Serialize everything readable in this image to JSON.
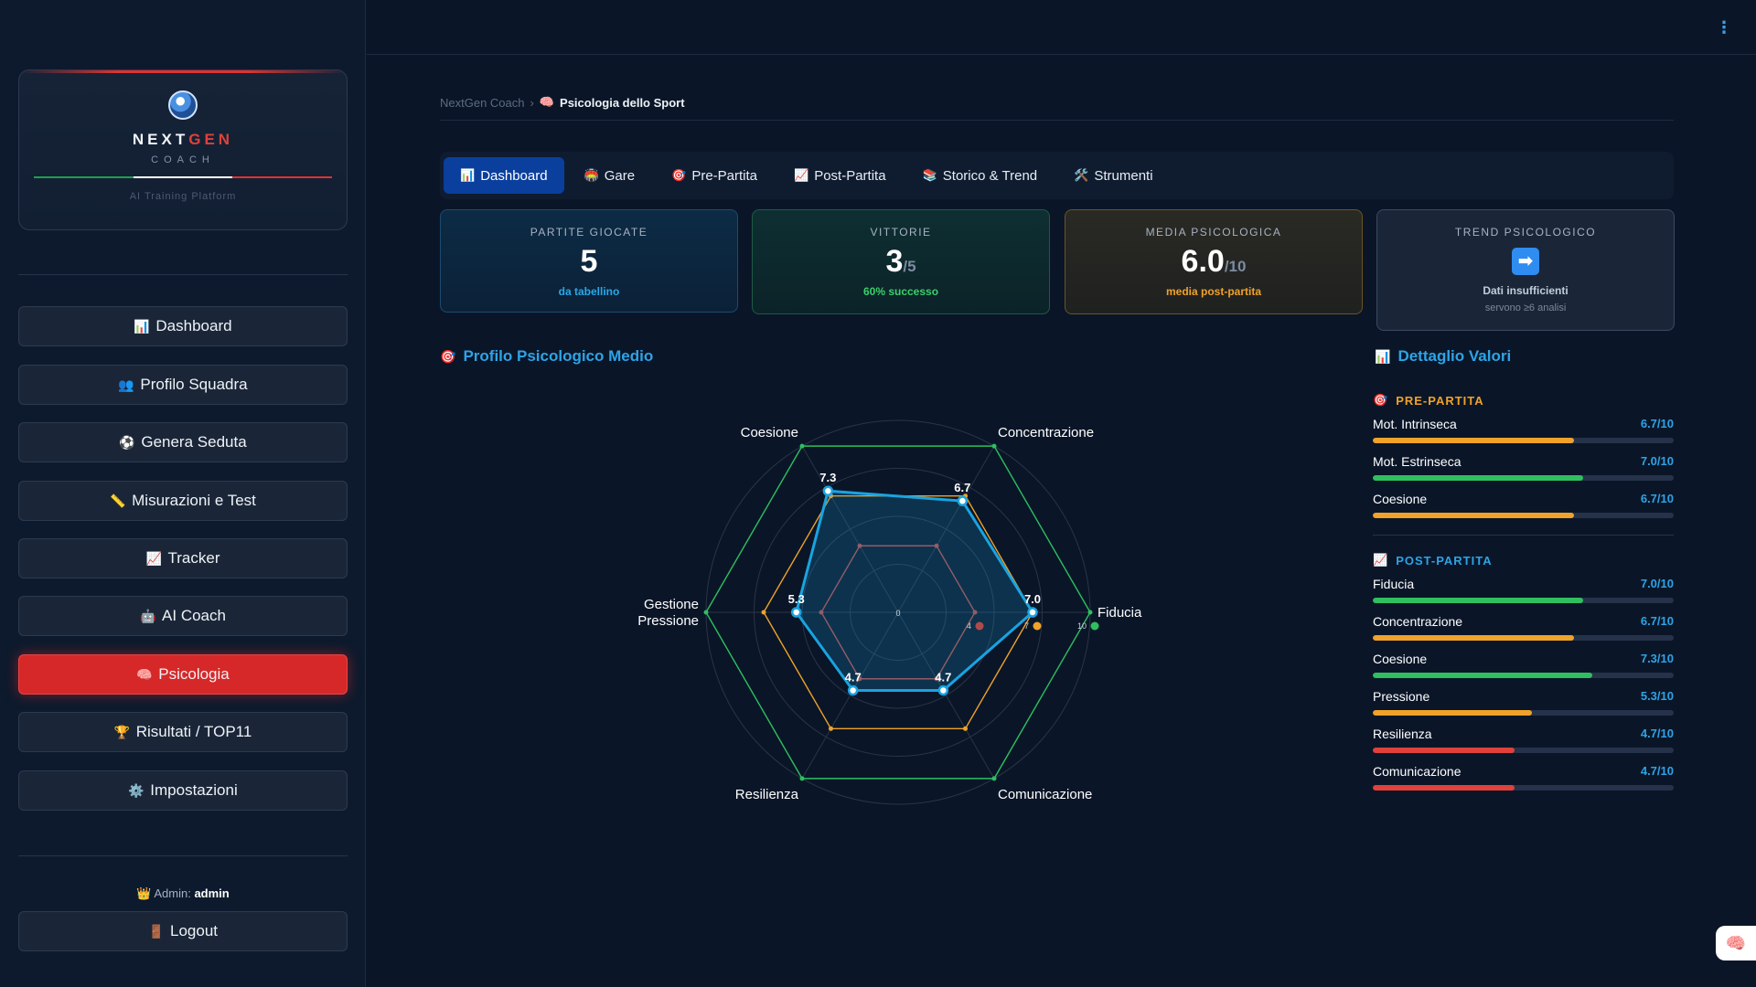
{
  "brand": {
    "name_a": "NEXT",
    "name_b": "GEN",
    "sub": "COACH",
    "tagline": "AI Training Platform",
    "colors": [
      "#1fa04a",
      "#ffffff",
      "#e0332f"
    ]
  },
  "sidebar": {
    "items": [
      {
        "icon": "📊",
        "icon_name": "chart-icon",
        "label": "Dashboard"
      },
      {
        "icon": "👥",
        "icon_name": "team-icon",
        "label": "Profilo Squadra"
      },
      {
        "icon": "⚽",
        "icon_name": "ball-icon",
        "label": "Genera Seduta"
      },
      {
        "icon": "📏",
        "icon_name": "ruler-icon",
        "label": "Misurazioni e Test"
      },
      {
        "icon": "📈",
        "icon_name": "trend-icon",
        "label": "Tracker"
      },
      {
        "icon": "🤖",
        "icon_name": "robot-icon",
        "label": "AI Coach"
      },
      {
        "icon": "🧠",
        "icon_name": "brain-icon",
        "label": "Psicologia",
        "active": true
      },
      {
        "icon": "🏆",
        "icon_name": "trophy-icon",
        "label": "Risultati / TOP11"
      },
      {
        "icon": "⚙️",
        "icon_name": "gear-icon",
        "label": "Impostazioni"
      }
    ],
    "admin_prefix": "Admin:",
    "admin_name": "admin",
    "admin_icon": "👑",
    "logout_icon": "🚪",
    "logout": "Logout"
  },
  "header": {
    "menu_icon": "⋮"
  },
  "breadcrumb": {
    "root": "NextGen Coach",
    "separator": "›",
    "icon": "🧠",
    "current": "Psicologia dello Sport"
  },
  "tabs": [
    {
      "icon": "📊",
      "label": "Dashboard",
      "active": true
    },
    {
      "icon": "🏟️",
      "label": "Gare"
    },
    {
      "icon": "🎯",
      "label": "Pre-Partita"
    },
    {
      "icon": "📈",
      "label": "Post-Partita"
    },
    {
      "icon": "📚",
      "label": "Storico & Trend"
    },
    {
      "icon": "🛠️",
      "label": "Strumenti"
    }
  ],
  "stats": {
    "played": {
      "label": "PARTITE GIOCATE",
      "value": "5",
      "note": "da tabellino"
    },
    "wins": {
      "label": "VITTORIE",
      "value": "3",
      "suffix": "/5",
      "note": "60% successo"
    },
    "media": {
      "label": "MEDIA PSICOLOGICA",
      "value": "6.0",
      "suffix": "/10",
      "note": "media post-partita"
    },
    "trend": {
      "label": "TREND PSICOLOGICO",
      "arrow": "➡",
      "note": "Dati insufficienti",
      "sub": "servono ≥6 analisi"
    }
  },
  "radar_section": {
    "icon": "🎯",
    "title": "Profilo Psicologico Medio"
  },
  "chart_data": {
    "type": "radar",
    "axes": [
      "Fiducia",
      "Concentrazione",
      "Coesione",
      "Gestione Pressione",
      "Resilienza",
      "Comunicazione"
    ],
    "range": [
      0,
      10
    ],
    "reference_rings": [
      {
        "value": 10,
        "color": "#2fbf5f",
        "tick_label": "10"
      },
      {
        "value": 7,
        "color": "#f0a22a",
        "tick_label": "7"
      },
      {
        "value": 4,
        "color": "#b04a4a",
        "tick_label": "4"
      }
    ],
    "center_label": "0",
    "series": [
      {
        "values": [
          7.0,
          6.7,
          7.3,
          5.3,
          4.7,
          4.7
        ],
        "labels": [
          "7.0",
          "6.7",
          "7.3",
          "5.3",
          "4.7",
          "4.7"
        ],
        "color": "#1aa3e0"
      }
    ]
  },
  "details": {
    "icon": "📊",
    "title": "Dettaglio Valori",
    "pre": {
      "icon": "🎯",
      "title": "PRE-PARTITA",
      "items": [
        {
          "name": "Mot. Intrinseca",
          "value": "6.7/10",
          "score": 6.7,
          "color": "#f0a22a"
        },
        {
          "name": "Mot. Estrinseca",
          "value": "7.0/10",
          "score": 7.0,
          "color": "#2fbf5f"
        },
        {
          "name": "Coesione",
          "value": "6.7/10",
          "score": 6.7,
          "color": "#f0a22a"
        }
      ]
    },
    "post": {
      "icon": "📈",
      "title": "POST-PARTITA",
      "items": [
        {
          "name": "Fiducia",
          "value": "7.0/10",
          "score": 7.0,
          "color": "#2fbf5f"
        },
        {
          "name": "Concentrazione",
          "value": "6.7/10",
          "score": 6.7,
          "color": "#f0a22a"
        },
        {
          "name": "Coesione",
          "value": "7.3/10",
          "score": 7.3,
          "color": "#2fbf5f"
        },
        {
          "name": "Pressione",
          "value": "5.3/10",
          "score": 5.3,
          "color": "#f0a22a"
        },
        {
          "name": "Resilienza",
          "value": "4.7/10",
          "score": 4.7,
          "color": "#e0413b"
        },
        {
          "name": "Comunicazione",
          "value": "4.7/10",
          "score": 4.7,
          "color": "#e0413b"
        }
      ]
    }
  },
  "fab": {
    "icon": "🧠"
  }
}
